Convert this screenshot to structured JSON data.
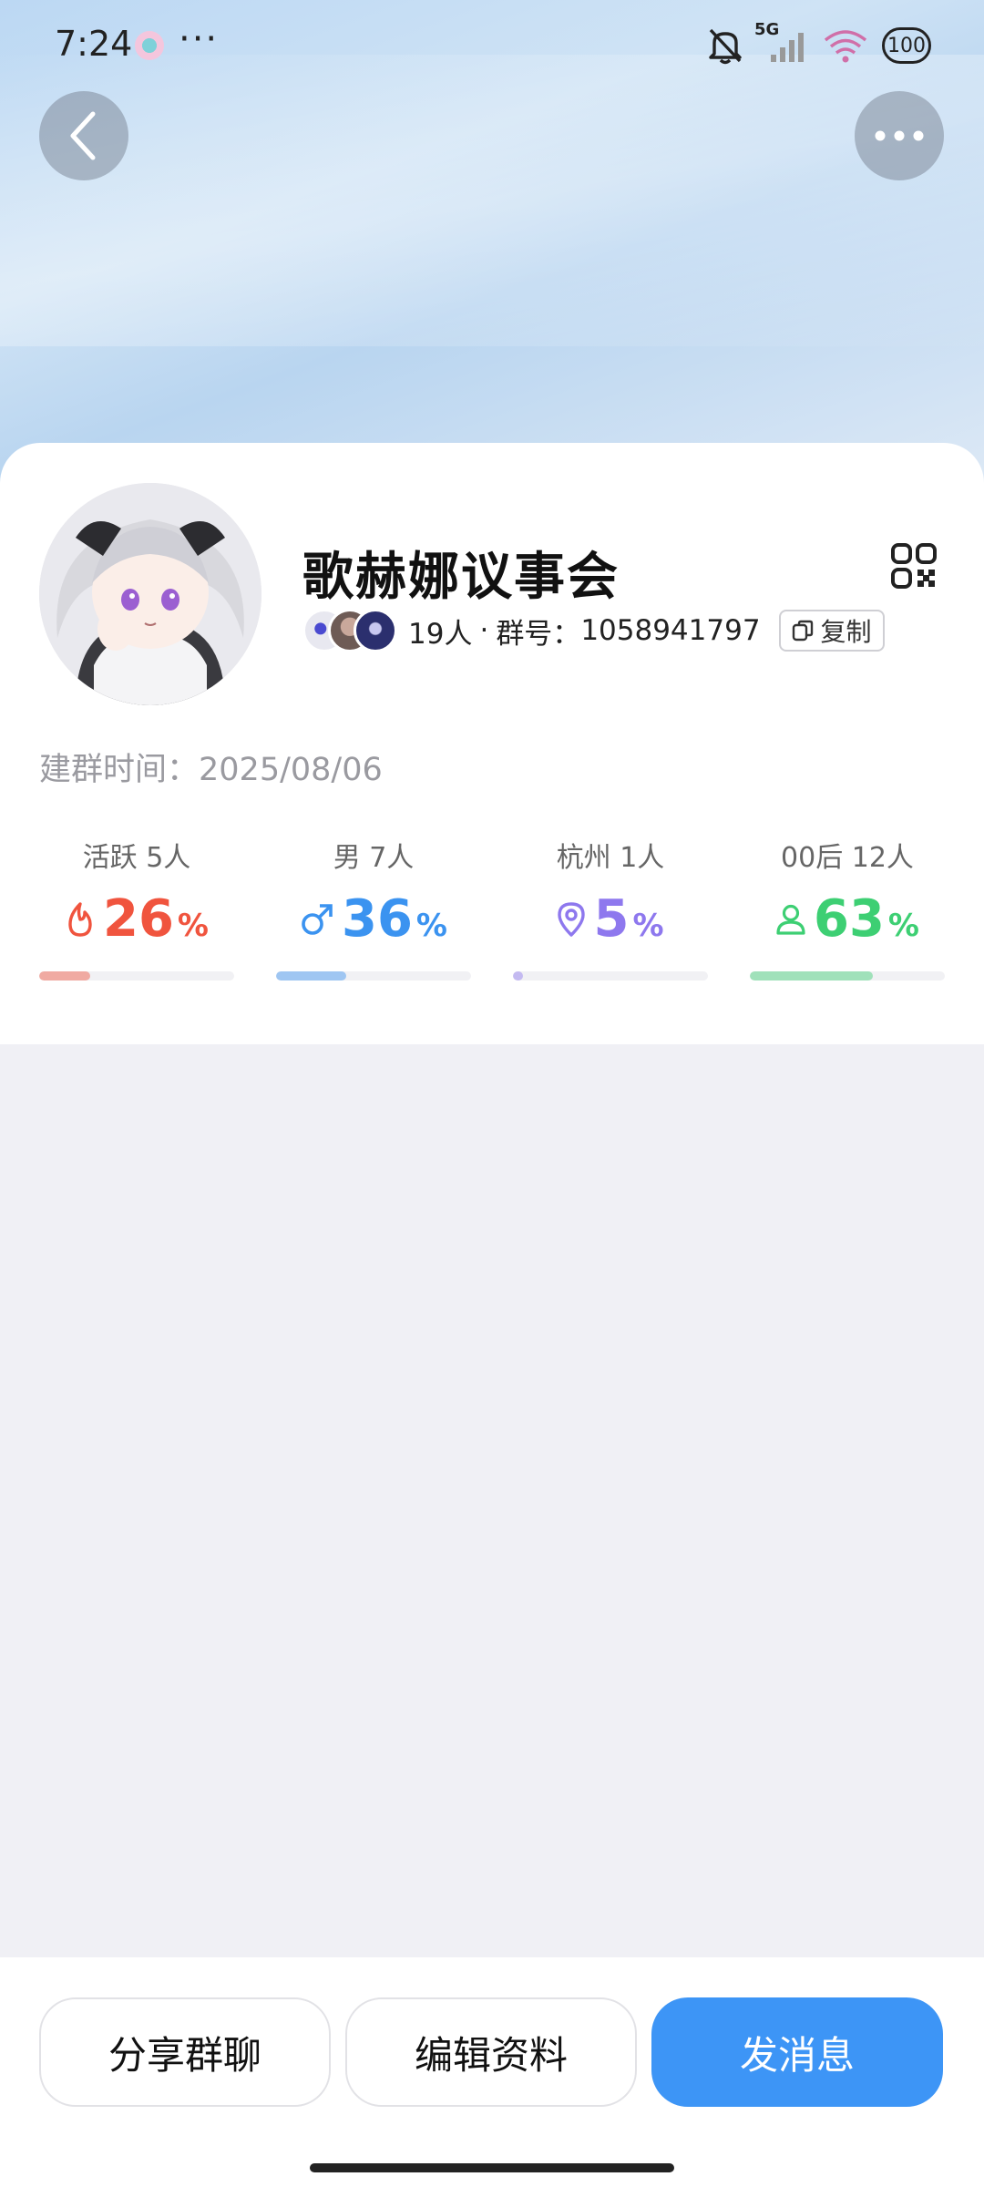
{
  "status_bar": {
    "time": "7:24",
    "more": "···",
    "network": "5G",
    "battery": "100"
  },
  "header": {
    "back_icon": "chevron-left-icon",
    "more_icon": "more-horizontal-icon"
  },
  "group": {
    "name": "歌赫娜议事会",
    "member_count": "19人",
    "separator": "·",
    "id_label": "群号：",
    "id_value": "1058941797",
    "copy_label": "复制",
    "created_label": "建群时间：",
    "created_value": "2025/08/06"
  },
  "stats": [
    {
      "label": "活跃 5人",
      "value": "26",
      "unit": "%",
      "fraction": 0.26,
      "color": "#f0543e",
      "icon": "flame-icon"
    },
    {
      "label": "男 7人",
      "value": "36",
      "unit": "%",
      "fraction": 0.36,
      "color": "#3b93f0",
      "icon": "male-icon"
    },
    {
      "label": "杭州 1人",
      "value": "5",
      "unit": "%",
      "fraction": 0.05,
      "color": "#8e78ee",
      "icon": "location-pin-icon"
    },
    {
      "label": "00后 12人",
      "value": "63",
      "unit": "%",
      "fraction": 0.63,
      "color": "#3dcf73",
      "icon": "person-icon"
    }
  ],
  "actions": {
    "share": "分享群聊",
    "edit": "编辑资料",
    "message": "发消息"
  }
}
